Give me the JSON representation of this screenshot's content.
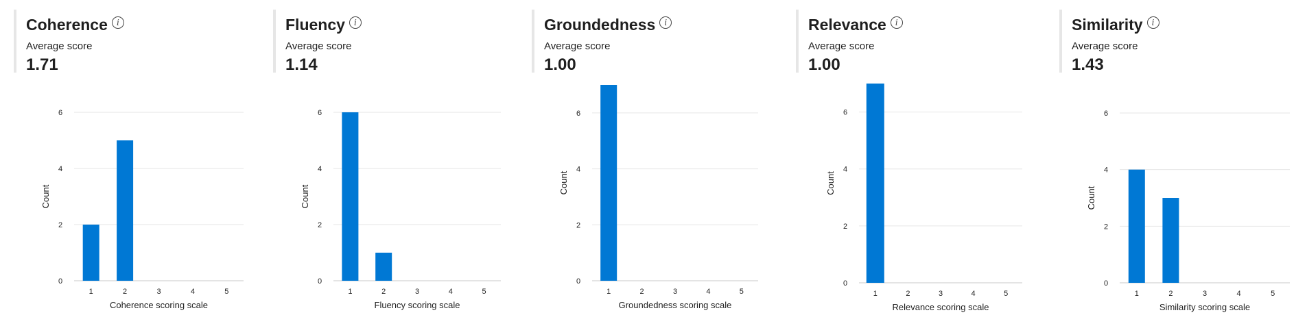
{
  "chart_data": [
    {
      "type": "bar",
      "title": "Coherence",
      "subtitle_label": "Average score",
      "average": "1.71",
      "categories": [
        "1",
        "2",
        "3",
        "4",
        "5"
      ],
      "values": [
        2,
        5,
        0,
        0,
        0
      ],
      "xlabel": "Coherence scoring scale",
      "ylabel": "Count",
      "ylim": [
        0,
        6
      ],
      "yticks": [
        0,
        2,
        4,
        6
      ],
      "grid": true
    },
    {
      "type": "bar",
      "title": "Fluency",
      "subtitle_label": "Average score",
      "average": "1.14",
      "categories": [
        "1",
        "2",
        "3",
        "4",
        "5"
      ],
      "values": [
        6,
        1,
        0,
        0,
        0
      ],
      "xlabel": "Fluency scoring scale",
      "ylabel": "Count",
      "ylim": [
        0,
        6
      ],
      "yticks": [
        0,
        2,
        4,
        6
      ],
      "grid": true
    },
    {
      "type": "bar",
      "title": "Groundedness",
      "subtitle_label": "Average score",
      "average": "1.00",
      "categories": [
        "1",
        "2",
        "3",
        "4",
        "5"
      ],
      "values": [
        7,
        0,
        0,
        0,
        0
      ],
      "xlabel": "Groundedness scoring scale",
      "ylabel": "Count",
      "ylim": [
        0,
        7
      ],
      "yticks": [
        0,
        2,
        4,
        6
      ],
      "grid": true
    },
    {
      "type": "bar",
      "title": "Relevance",
      "subtitle_label": "Average score",
      "average": "1.00",
      "categories": [
        "1",
        "2",
        "3",
        "4",
        "5"
      ],
      "values": [
        7,
        0,
        0,
        0,
        0
      ],
      "xlabel": "Relevance scoring scale",
      "ylabel": "Count",
      "ylim": [
        0,
        7
      ],
      "yticks": [
        0,
        2,
        4,
        6
      ],
      "grid": true
    },
    {
      "type": "bar",
      "title": "Similarity",
      "subtitle_label": "Average score",
      "average": "1.43",
      "categories": [
        "1",
        "2",
        "3",
        "4",
        "5"
      ],
      "values": [
        4,
        3,
        0,
        0,
        0
      ],
      "xlabel": "Similarity scoring scale",
      "ylabel": "Count",
      "ylim": [
        0,
        6
      ],
      "yticks": [
        0,
        2,
        4,
        6
      ],
      "grid": true
    }
  ],
  "colors": {
    "bar": "#0078d4",
    "grid": "#e6e6e6",
    "axis": "#c8c8c8",
    "card_border": "#e6e6e6"
  },
  "icons": {
    "info": "info-icon"
  }
}
